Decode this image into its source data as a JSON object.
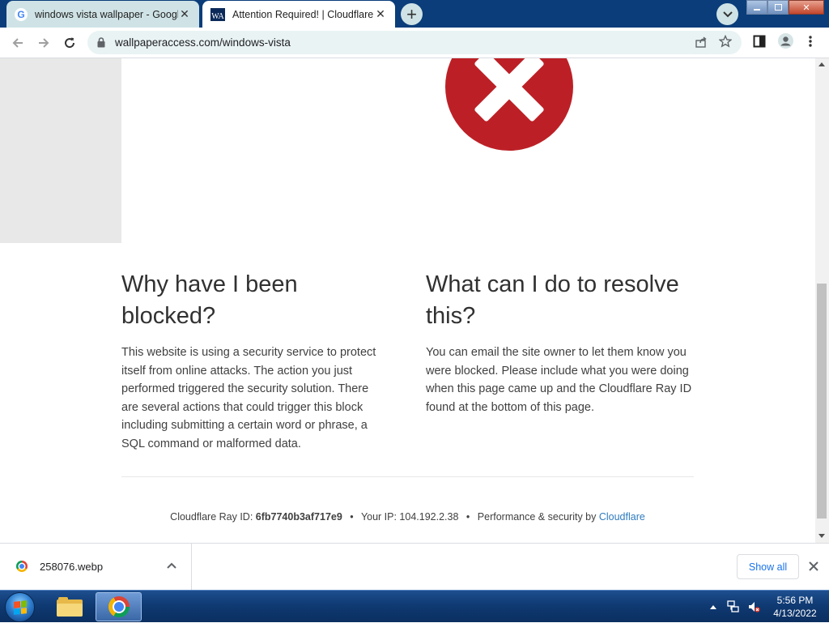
{
  "tabs": [
    {
      "title": "windows vista wallpaper - Google",
      "favicon": "google-icon",
      "active": false
    },
    {
      "title": "Attention Required! | Cloudflare",
      "favicon": "wallpaperaccess-icon",
      "favicon_text": "WA",
      "active": true
    }
  ],
  "omnibox": {
    "url": "wallpaperaccess.com/windows-vista"
  },
  "page": {
    "left_heading": "Why have I been blocked?",
    "left_body": "This website is using a security service to protect itself from online attacks. The action you just performed triggered the security solution. There are several actions that could trigger this block including submitting a certain word or phrase, a SQL command or malformed data.",
    "right_heading": "What can I do to resolve this?",
    "right_body": "You can email the site owner to let them know you were blocked. Please include what you were doing when this page came up and the Cloudflare Ray ID found at the bottom of this page.",
    "footer": {
      "ray_label": "Cloudflare Ray ID:",
      "ray_id": "6fb7740b3af717e9",
      "separator": "•",
      "ip_text": "Your IP: 104.192.2.38",
      "perf_text": "Performance & security by Cloudflare",
      "link_text": "Cloudflare"
    },
    "colors": {
      "error_red": "#bc2026",
      "link_blue": "#2f7bbf"
    }
  },
  "download_shelf": {
    "filename": "258076.webp",
    "show_all_label": "Show all"
  },
  "taskbar": {
    "time": "5:56 PM",
    "date": "4/13/2022"
  }
}
